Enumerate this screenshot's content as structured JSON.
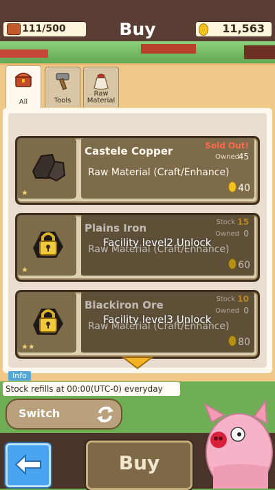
{
  "header": {
    "title": "Buy",
    "inventory": "111/500",
    "coins": "11,563"
  },
  "tabs": [
    {
      "label": "All",
      "icon": "chest-icon",
      "active": true
    },
    {
      "label": "Tools",
      "icon": "hammer-icon",
      "active": false
    },
    {
      "label": "Raw Material",
      "icon": "sack-icon",
      "active": false
    }
  ],
  "items": [
    {
      "name": "Castele Copper",
      "category": "Raw Material (Craft/Enhance)",
      "price": "40",
      "owned_label": "Owned",
      "owned": "45",
      "status": "Sold Out!"
    },
    {
      "name": "Plains Iron",
      "category": "Raw Material (Craft/Enhance)",
      "price": "60",
      "stock_label": "Stock",
      "stock": "15",
      "owned_label": "Owned",
      "owned": "0",
      "lock": "Facility level2 Unlock"
    },
    {
      "name": "Blackiron Ore",
      "category": "Raw Material (Craft/Enhance)",
      "price": "80",
      "stock_label": "Stock",
      "stock": "10",
      "owned_label": "Owned",
      "owned": "0",
      "lock": "Facility level3 Unlock"
    }
  ],
  "info": {
    "tag": "Info",
    "text": "Stock refills at 00:00(UTC-0) everyday"
  },
  "buttons": {
    "switch": "Switch",
    "buy": "Buy"
  },
  "colors": {
    "panel": "#f0c988",
    "topbar": "#5a3e33",
    "accent_blue": "#4aa4ef",
    "sold_out": "#ff6a4b",
    "stock": "#ffb22c"
  }
}
